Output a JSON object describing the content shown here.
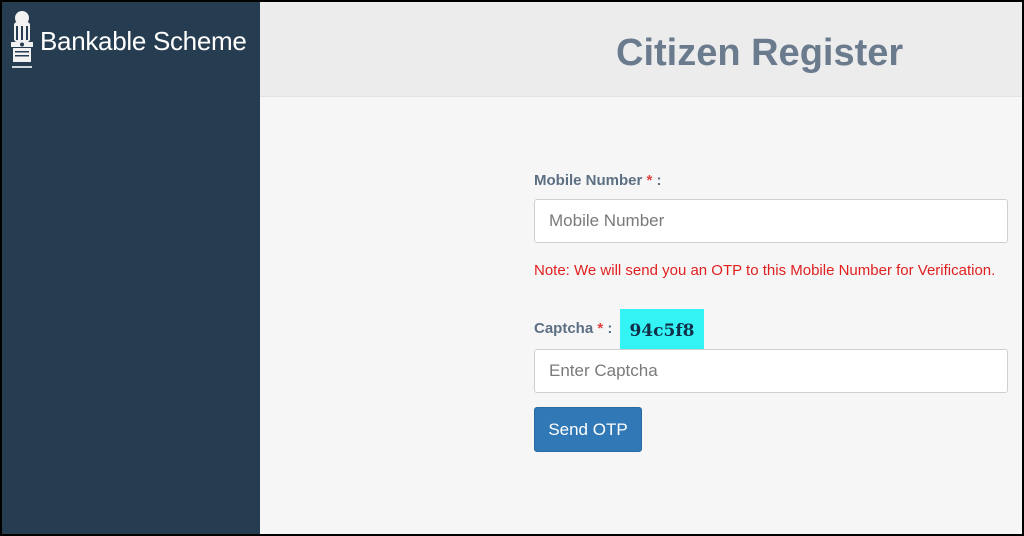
{
  "app": {
    "brand": "Bankable Scheme"
  },
  "header": {
    "title": "Citizen Register"
  },
  "form": {
    "mobile": {
      "label": "Mobile Number",
      "required_mark": "*",
      "suffix": " :",
      "placeholder": "Mobile Number",
      "value": ""
    },
    "note": "Note: We will send you an OTP to this Mobile Number for Verification.",
    "captcha": {
      "label": "Captcha",
      "required_mark": "*",
      "suffix": " :",
      "code": "94c5f8",
      "placeholder": "Enter Captcha",
      "value": ""
    },
    "submit_label": "Send OTP"
  },
  "colors": {
    "sidebar": "#263c50",
    "accent_button": "#3178b6",
    "note_text": "#e02020",
    "captcha_bg": "#33f3f5"
  },
  "icons": {
    "logo": "national-emblem-icon"
  }
}
